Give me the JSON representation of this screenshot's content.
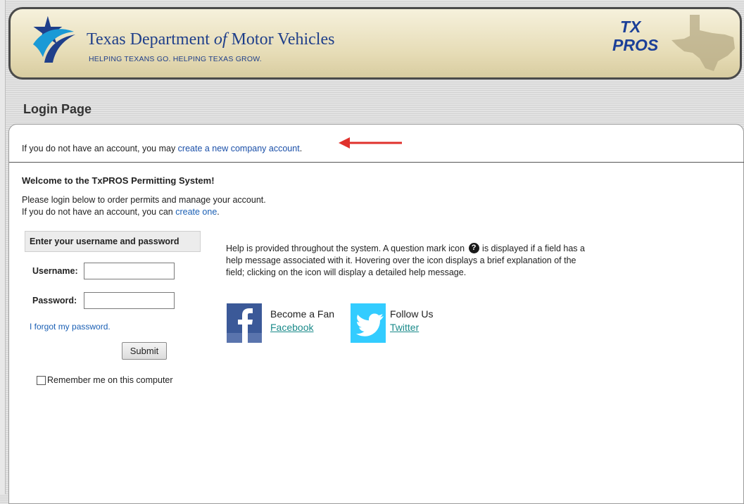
{
  "header": {
    "agency_name_part1": "Texas Department ",
    "agency_name_of": "of",
    "agency_name_part2": " Motor Vehicles",
    "tagline": "HELPING TEXANS GO. HELPING TEXAS GROW.",
    "product_logo_line1": "TX",
    "product_logo_line2": "PROS",
    "logo_icon": "txdmv-star-logo",
    "product_map_icon": "texas-map-icon"
  },
  "page": {
    "title": "Login Page"
  },
  "notice": {
    "text": "If you do not have an account, you may ",
    "link": "create a new company account",
    "suffix": "."
  },
  "welcome": {
    "heading": "Welcome to the TxPROS Permitting System!",
    "line1": "Please login below to order permits and manage your account.",
    "line2_prefix": "If you do not have an account, you can ",
    "line2_link": "create one",
    "line2_suffix": "."
  },
  "login": {
    "box_title": "Enter your username and password",
    "username_label": "Username:",
    "username_value": "",
    "password_label": "Password:",
    "password_value": "",
    "forgot_link": "I forgot my password.",
    "submit_label": "Submit",
    "remember_label": "Remember me on this computer"
  },
  "help": {
    "text_before_icon": "Help is provided throughout the system. A question mark icon ",
    "icon_glyph": "?",
    "text_after_icon": " is displayed if a field has a help message associated with it. Hovering over the icon displays a brief explanation of the field; clicking on the icon will display a detailed help message."
  },
  "social": {
    "facebook_heading": "Become a Fan",
    "facebook_link": "Facebook",
    "twitter_heading": "Follow Us",
    "twitter_link": "Twitter"
  },
  "colors": {
    "link": "#1a4fa8",
    "facebook": "#3b5998",
    "twitter": "#33ccff",
    "arrow": "#e0312c",
    "brand_blue": "#1f3f8a"
  }
}
